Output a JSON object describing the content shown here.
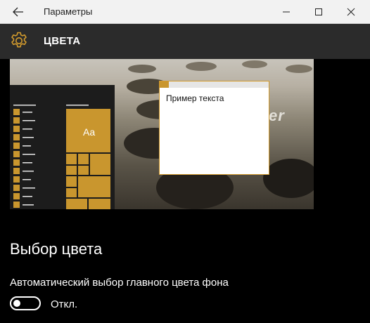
{
  "window": {
    "title": "Параметры",
    "controls": [
      "minimize-icon",
      "maximize-icon",
      "close-icon"
    ]
  },
  "header": {
    "icon": "gear-icon",
    "title": "ЦВЕТА"
  },
  "preview": {
    "sample_text": "Пример текста",
    "wallpaper_text": "er",
    "tile_label": "Aa",
    "accent_color": "#c9962e"
  },
  "colors_section": {
    "title": "Выбор цвета",
    "auto_color_label": "Автоматический выбор главного цвета фона",
    "toggle_state": "Откл.",
    "toggle_on": false
  }
}
